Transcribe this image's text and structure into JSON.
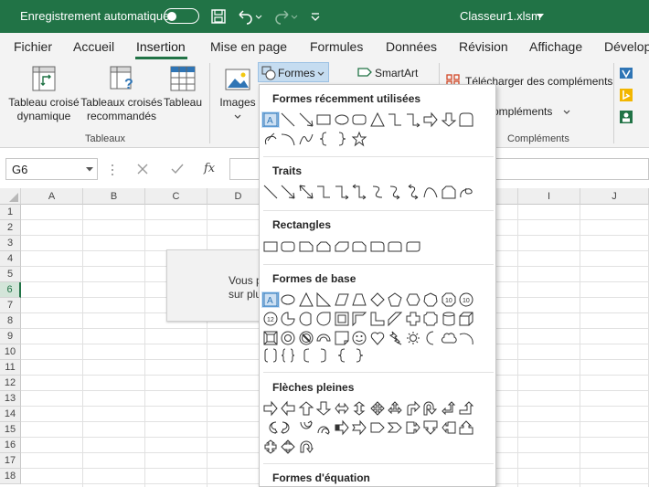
{
  "titlebar": {
    "autosave_label": "Enregistrement automatique",
    "filename": "Classeur1.xlsm"
  },
  "tabs": [
    "Fichier",
    "Accueil",
    "Insertion",
    "Mise en page",
    "Formules",
    "Données",
    "Révision",
    "Affichage",
    "Dévelop"
  ],
  "active_tab": "Insertion",
  "ribbon": {
    "pivot_line1": "Tableau croisé",
    "pivot_line2": "dynamique",
    "rec_line1": "Tableaux croisés",
    "rec_line2": "recommandés",
    "table_label": "Tableau",
    "group_tables": "Tableaux",
    "images_label": "Images",
    "shapes_label": "Formes",
    "smartart_label": "SmartArt",
    "get_addins_label": "Télécharger des compléments",
    "my_addins_label": "ompléments",
    "group_addins": "Compléments"
  },
  "formula_bar": {
    "name_box": "G6",
    "fx": "fx"
  },
  "grid": {
    "columns": [
      "A",
      "B",
      "C",
      "D",
      "I",
      "J"
    ],
    "rows": [
      "1",
      "2",
      "3",
      "4",
      "5",
      "6",
      "7",
      "8",
      "9",
      "10",
      "11",
      "12",
      "13",
      "14",
      "15",
      "16",
      "17",
      "18"
    ],
    "selected_row": "6"
  },
  "message_box": {
    "line1": "Vous p",
    "line2": "sur plu"
  },
  "shapes_menu": {
    "sections": {
      "recent": "Formes récemment utilisées",
      "lines": "Traits",
      "rectangles": "Rectangles",
      "basic": "Formes de base",
      "arrows": "Flèches pleines",
      "equation": "Formes d'équation"
    }
  },
  "colors": {
    "excel_green": "#217346",
    "ribbon_bg": "#f3f3f3",
    "selection_blue": "#5b9bd5"
  }
}
